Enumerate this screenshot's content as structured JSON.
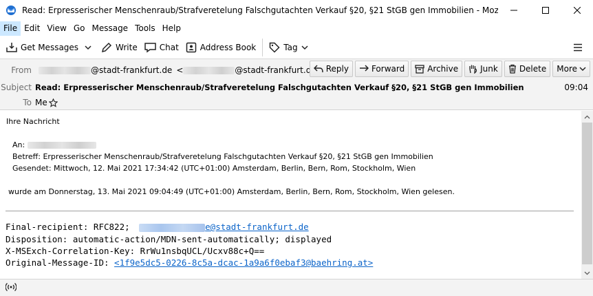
{
  "window": {
    "title": "Read: Erpresserischer Menschenraub/Strafveretelung Falschgutachten Verkauf §20, §21 StGB gen Immobilien - Mozilla Thunderbird"
  },
  "menu": [
    "File",
    "Edit",
    "View",
    "Go",
    "Message",
    "Tools",
    "Help"
  ],
  "toolbar": {
    "get_messages": "Get Messages",
    "write": "Write",
    "chat": "Chat",
    "address_book": "Address Book",
    "tag": "Tag"
  },
  "header": {
    "from_label": "From",
    "from_domain": "@stadt-frankfurt.de",
    "from_lt": "<",
    "from_addr_domain": "@stadt-frankfurt.de>",
    "subject_label": "Subject",
    "subject": "Read: Erpresserischer Menschenraub/Strafveretelung Falschgutachten Verkauf §20, §21 StGB gen Immobilien",
    "time": "09:04",
    "to_label": "To",
    "to": "Me",
    "actions": {
      "reply": "Reply",
      "forward": "Forward",
      "archive": "Archive",
      "junk": "Junk",
      "delete": "Delete",
      "more": "More"
    }
  },
  "body": {
    "line1": "Ihre Nachricht",
    "an_label": "An:",
    "betreff": "Betreff: Erpresserischer Menschenraub/Strafveretelung Falschgutachten Verkauf §20, §21 StGB gen Immobilien",
    "gesendet": "Gesendet: Mittwoch, 12. Mai 2021 17:34:42 (UTC+01:00) Amsterdam, Berlin, Bern, Rom, Stockholm, Wien",
    "gelesen": "wurde am Donnerstag, 13. Mai 2021 09:04:49 (UTC+01:00) Amsterdam, Berlin, Bern, Rom, Stockholm, Wien gelesen.",
    "final_recipient_label": "Final-recipient: RFC822;",
    "final_recipient_domain": "e@stadt-frankfurt.de",
    "disposition": "Disposition: automatic-action/MDN-sent-automatically; displayed",
    "correlation": "X-MSExch-Correlation-Key: RrWu1nsbqUCL/Ucxv88c+Q==",
    "original_label": "Original-Message-ID:",
    "original_id": "<1f9e5dc5-0226-8c5a-dcac-1a9a6f0ebaf3@baehring.at>"
  },
  "colors": {
    "link": "#0a63c9",
    "header_bg": "#f3f3f3",
    "menu_active": "#cce8ff"
  }
}
